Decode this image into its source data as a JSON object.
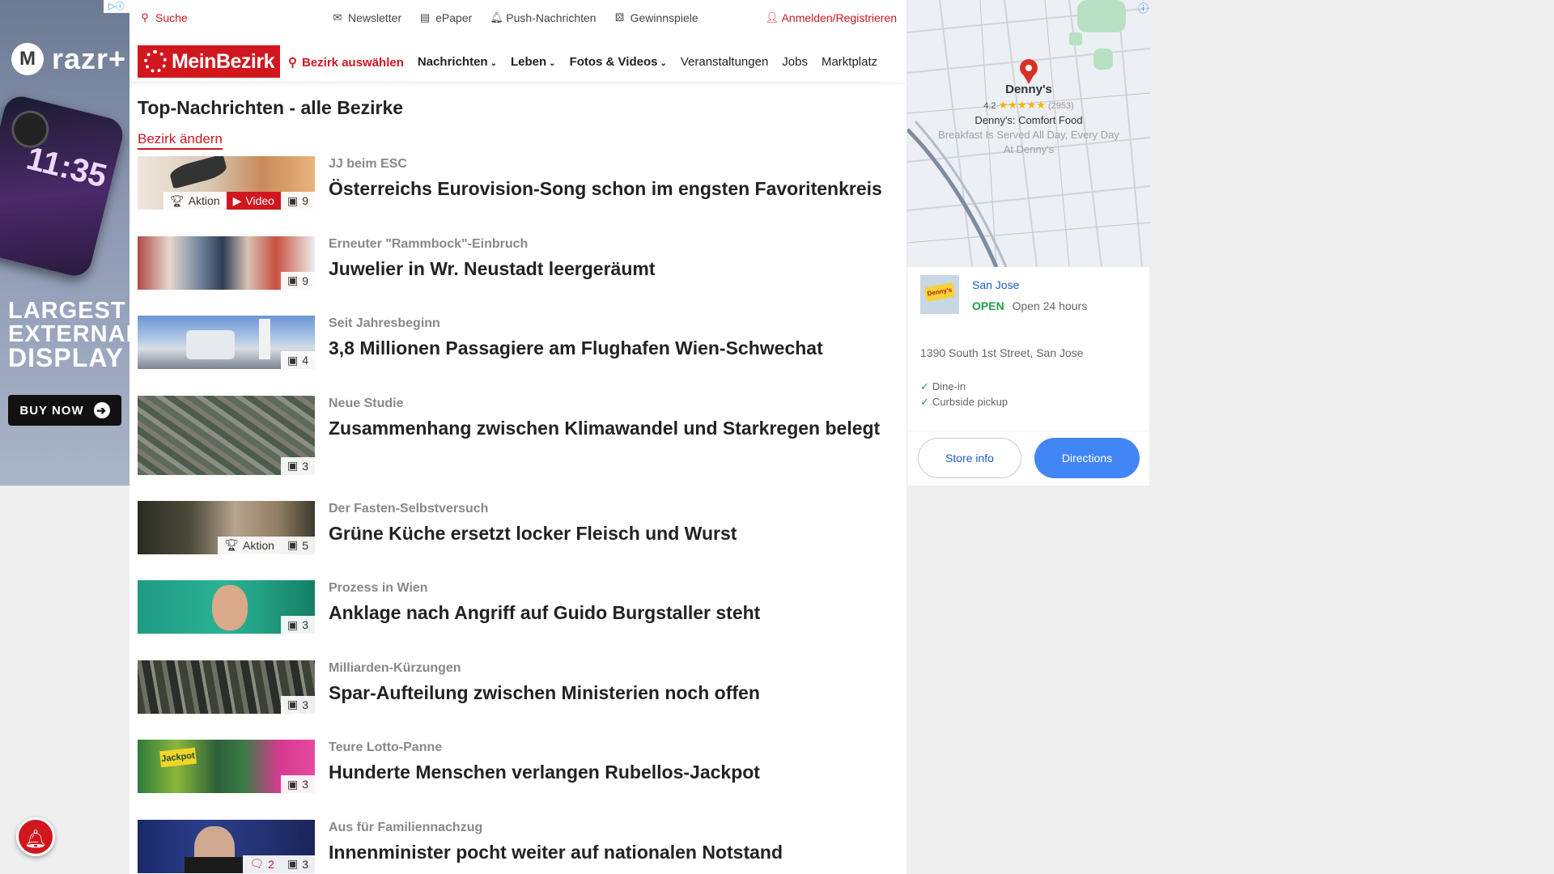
{
  "left_ad": {
    "choice": "▷ⓘ",
    "brand": "razr+",
    "clock": "11:35",
    "headline_1": "LARGEST",
    "headline_2": "EXTERNAL",
    "headline_3": "DISPLAY",
    "cta": "BUY NOW"
  },
  "topbar": {
    "search": "Suche",
    "newsletter": "Newsletter",
    "epaper": "ePaper",
    "push": "Push-Nachrichten",
    "games": "Gewinnspiele",
    "login": "Anmelden/Registrieren"
  },
  "nav": {
    "logo": "MeinBezirk",
    "bezirk": "Bezirk auswählen",
    "nachrichten": "Nachrichten",
    "leben": "Leben",
    "fotos": "Fotos & Videos",
    "veranstaltungen": "Veranstaltungen",
    "jobs": "Jobs",
    "marktplatz": "Marktplatz"
  },
  "section": {
    "title": "Top-Nachrichten - alle Bezirke",
    "change": "Bezirk ändern"
  },
  "articles": [
    {
      "kicker": "JJ beim ESC",
      "title": "Österreichs Eurovision-Song schon im engsten Favoritenkreis",
      "aktion": "Aktion",
      "video": "Video",
      "photos": "9"
    },
    {
      "kicker": "Erneuter \"Rammbock\"-Einbruch",
      "title": "Juwelier in Wr. Neustadt leergeräumt",
      "photos": "9"
    },
    {
      "kicker": "Seit Jahresbeginn",
      "title": "3,8 Millionen Passagiere am Flughafen Wien-Schwechat",
      "photos": "4"
    },
    {
      "kicker": "Neue Studie",
      "title": "Zusammenhang zwischen Klimawandel und Starkregen belegt",
      "photos": "3"
    },
    {
      "kicker": "Der Fasten-Selbstversuch",
      "title": "Grüne Küche ersetzt locker Fleisch und Wurst",
      "aktion": "Aktion",
      "photos": "5"
    },
    {
      "kicker": "Prozess in Wien",
      "title": "Anklage nach Angriff auf Guido Burgstaller steht",
      "photos": "3"
    },
    {
      "kicker": "Milliarden-Kürzungen",
      "title": "Spar-Aufteilung zwischen Ministerien noch offen",
      "photos": "3"
    },
    {
      "kicker": "Teure Lotto-Panne",
      "title": "Hunderte Menschen verlangen Rubellos-Jackpot",
      "photos": "3"
    },
    {
      "kicker": "Aus für Familiennachzug",
      "title": "Innenminister pocht weiter auf nationalen Notstand",
      "comments": "2",
      "photos": "3"
    }
  ],
  "right_ad": {
    "place": "Denny's",
    "rating": "4.2",
    "stars": "★★★★★",
    "reviews": "(2953)",
    "tagline": "Denny's: Comfort Food",
    "desc_1": "Breakfast Is Served All Day, Every Day",
    "desc_2": "At Denny's",
    "city": "San Jose",
    "status": "OPEN",
    "hours": "Open 24 hours",
    "address": "1390 South 1st Street, San Jose",
    "feature_1": "Dine-in",
    "feature_2": "Curbside pickup",
    "store_info": "Store info",
    "directions": "Directions",
    "sign": "Denny's"
  },
  "colors": {
    "brand": "#d2161e",
    "map_button": "#4285f4",
    "open": "#1e9e4a"
  }
}
